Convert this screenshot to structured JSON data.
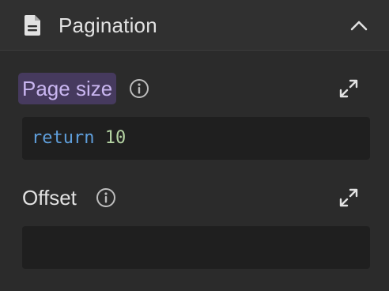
{
  "section": {
    "title": "Pagination",
    "header_icon": "document-icon",
    "collapse_icon": "chevron-up-icon"
  },
  "fields": {
    "page_size": {
      "label": "Page size",
      "info_icon": "info-icon",
      "expand_icon": "expand-icon",
      "code_keyword": "return",
      "code_value": "10"
    },
    "offset": {
      "label": "Offset",
      "info_icon": "info-icon",
      "expand_icon": "expand-icon",
      "code_keyword": "",
      "code_value": ""
    }
  },
  "colors": {
    "background": "#2b2b2b",
    "header_background": "#303030",
    "editor_background": "#1f1f1f",
    "label_highlight_background": "#463a5e",
    "label_highlight_text": "#c9b6f0",
    "keyword": "#5f9fdc",
    "number": "#b5d4a3"
  }
}
